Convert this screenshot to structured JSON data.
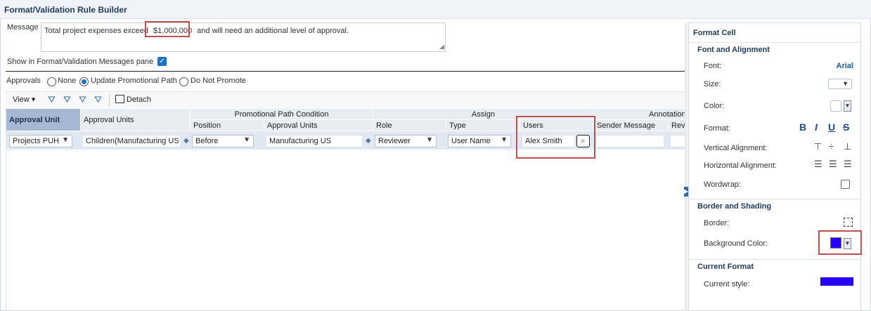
{
  "window": {
    "title": "Format/Validation Rule Builder"
  },
  "message": {
    "label": "Message",
    "text_before": "Total project expenses exceed",
    "text_highlight": "$1,000,000",
    "text_after": "and will need an additional level of approval."
  },
  "show_in_pane": {
    "label": "Show in Format/Validation Messages pane",
    "checked": true
  },
  "approvals": {
    "label": "Approvals",
    "options": [
      "None",
      "Update Promotional Path",
      "Do Not Promote"
    ],
    "selected": "Update Promotional Path"
  },
  "toolbar": {
    "view_label": "View",
    "detach_label": "Detach"
  },
  "grid": {
    "col_approval_unit": "Approval Unit",
    "col_approval_units": "Approval Units",
    "group_ppc": "Promotional Path Condition",
    "col_position": "Position",
    "col_ppc_units": "Approval Units",
    "group_assign": "Assign",
    "col_role": "Role",
    "col_type": "Type",
    "col_users": "Users",
    "group_annotation": "Annotation",
    "col_sender_message": "Sender Message",
    "col_review": "Revi",
    "row": {
      "approval_unit": "Projects PUH",
      "approval_units": "Children(Manufacturing US",
      "position": "Before",
      "ppc_units": "Manufacturing US",
      "role": "Reviewer",
      "type": "User Name",
      "users": "Alex Smith"
    }
  },
  "panel": {
    "title": "Format Cell",
    "font_alignment": {
      "title": "Font and Alignment",
      "font_label": "Font:",
      "font_value": "Arial",
      "size_label": "Size:",
      "color_label": "Color:",
      "format_label": "Format:",
      "vertical_label": "Vertical Alignment:",
      "horizontal_label": "Horizontal Alignment:",
      "wordwrap_label": "Wordwrap:"
    },
    "border_shading": {
      "title": "Border and Shading",
      "border_label": "Border:",
      "bg_label": "Background Color:",
      "bg_color": "#2600ff"
    },
    "current_format": {
      "title": "Current Format",
      "style_label": "Current style:"
    }
  }
}
